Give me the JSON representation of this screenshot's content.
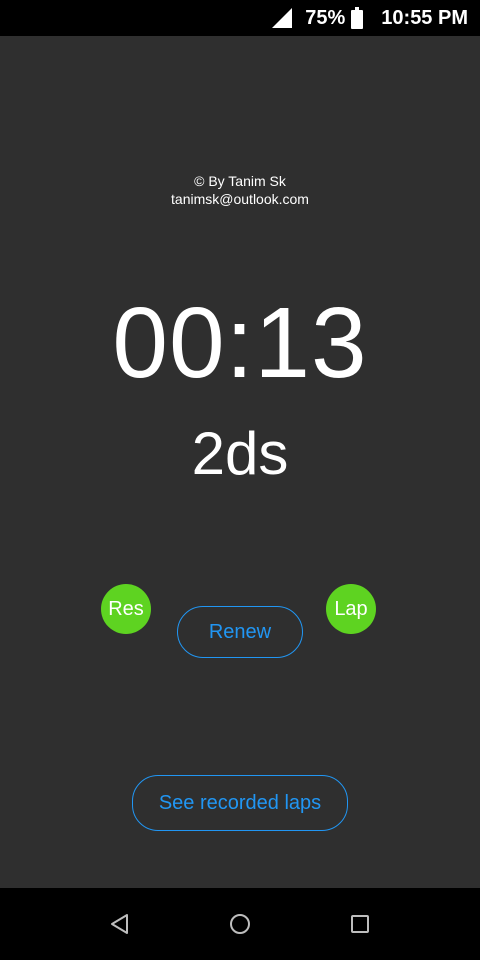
{
  "status_bar": {
    "battery_percent": "75%",
    "time": "10:55 PM"
  },
  "credit": {
    "author": "© By Tanim Sk",
    "email": "tanimsk@outlook.com"
  },
  "timer": {
    "display": "00:13",
    "deciseconds": "2ds"
  },
  "controls": {
    "reset_label": "Res",
    "lap_label": "Lap",
    "renew_label": "Renew",
    "laps_label": "See recorded laps"
  },
  "colors": {
    "background": "#2f2f2f",
    "accent_green": "#5ed321",
    "accent_blue": "#2196f3"
  },
  "icons": {
    "signal": "signal-icon",
    "battery": "battery-icon",
    "back": "back-triangle-icon",
    "home": "home-circle-icon",
    "recents": "recents-square-icon"
  }
}
